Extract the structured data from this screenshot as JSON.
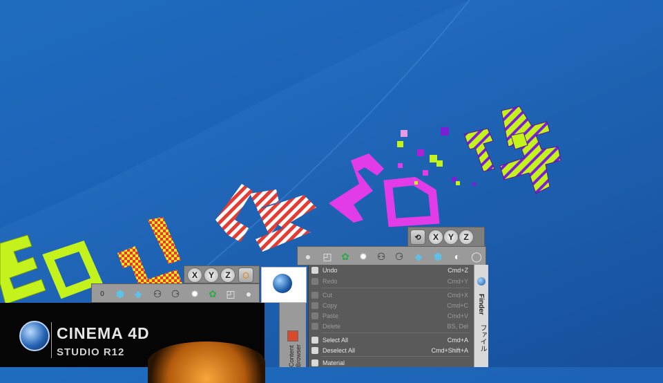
{
  "desktop": {
    "wallpaper": "blue-gradient",
    "year_digits": [
      "2",
      "0",
      "1",
      "2",
      "2",
      "0",
      "1",
      "4"
    ]
  },
  "toolbar_upper": {
    "xyz": [
      "X",
      "Y",
      "Z"
    ]
  },
  "toolbar_left": {
    "xyz": [
      "X",
      "Y",
      "Z"
    ],
    "coord_label": "0"
  },
  "context_menu": {
    "items": [
      {
        "label": "Undo",
        "shortcut": "Cmd+Z",
        "enabled": true
      },
      {
        "label": "Redo",
        "shortcut": "Cmd+Y",
        "enabled": false
      },
      {
        "label": "Cut",
        "shortcut": "Cmd+X",
        "enabled": false
      },
      {
        "label": "Copy",
        "shortcut": "Cmd+C",
        "enabled": false
      },
      {
        "label": "Paste",
        "shortcut": "Cmd+V",
        "enabled": false
      },
      {
        "label": "Delete",
        "shortcut": "BS, Del",
        "enabled": false
      },
      {
        "label": "Select All",
        "shortcut": "Cmd+A",
        "enabled": true
      },
      {
        "label": "Deselect All",
        "shortcut": "Cmd+Shift+A",
        "enabled": true
      },
      {
        "label": "Material",
        "shortcut": "",
        "enabled": true
      }
    ]
  },
  "side_tabs": {
    "finder": "Finder",
    "file": "ファイル"
  },
  "content_browser": {
    "label": "Content Browser"
  },
  "splash": {
    "title": "CINEMA 4D",
    "subtitle": "STUDIO R12"
  },
  "colors": {
    "lime": "#c4f21c",
    "magenta": "#e23be8",
    "purple": "#7b1fd6",
    "red": "#e53a2d",
    "yellow": "#f4e224"
  }
}
